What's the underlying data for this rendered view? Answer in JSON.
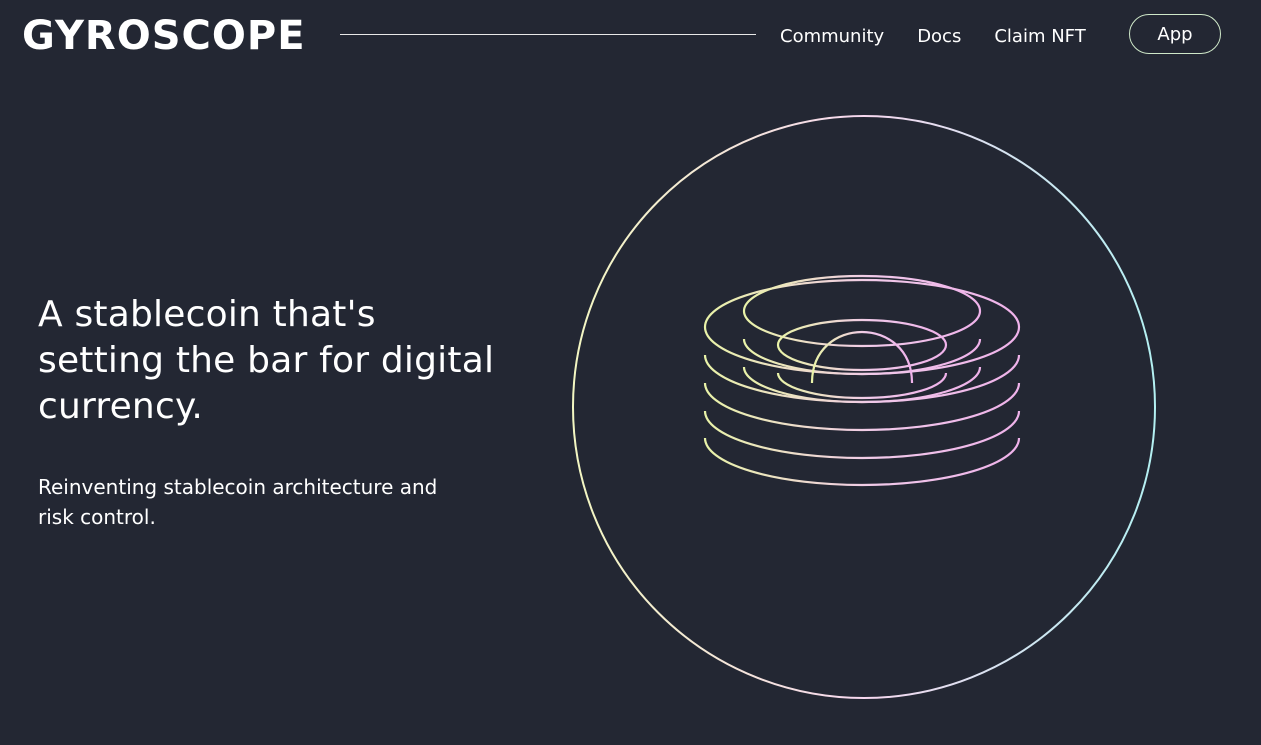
{
  "brand": {
    "name": "GYROSCOPE"
  },
  "nav": {
    "links": [
      "Community",
      "Docs",
      "Claim NFT"
    ],
    "app_button": "App"
  },
  "hero": {
    "headline": "A stablecoin that's setting the bar for digital currency.",
    "subhead": "Reinventing stablecoin architecture and risk control."
  },
  "colors": {
    "background": "#232733",
    "text": "#ffffff",
    "gradient_yellow": "#e8f5a8",
    "gradient_pink": "#f0b6ee",
    "gradient_cyan": "#a8eef2"
  },
  "icons": {
    "hero_art": "gyroscope-wireframe-illustration"
  }
}
